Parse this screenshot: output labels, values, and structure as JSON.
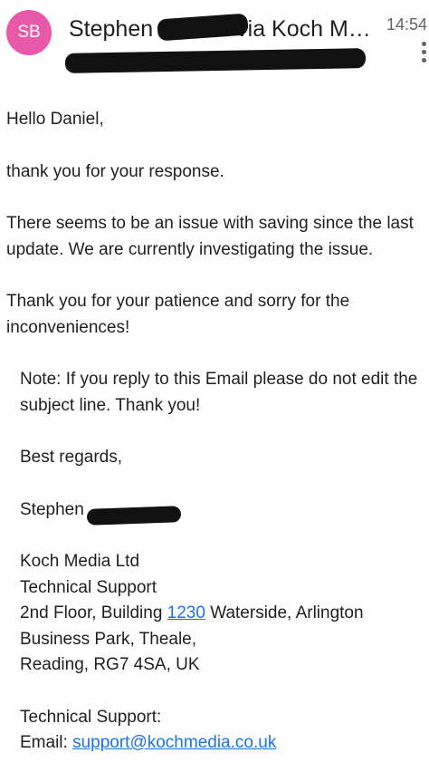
{
  "header": {
    "avatar_initials": "SB",
    "sender_first": "Stephen",
    "sender_via": "via Koch M…",
    "time": "14:54"
  },
  "email": {
    "greeting": "Hello Daniel,",
    "para1": "thank you for your response.",
    "para2": "There seems to be an issue with saving since the last update. We are currently investigating the issue.",
    "para3": "Thank you for your patience and sorry for the inconveniences!",
    "note": "Note: If you reply to this Email please do not edit the subject line. Thank you!",
    "closing": "Best regards,",
    "signature_name": "Stephen",
    "company": "Koch Media Ltd",
    "department": "Technical Support",
    "address_prefix": "2nd Floor, Building ",
    "address_link": "1230",
    "address_suffix": " Waterside, Arlington Business Park, Theale,",
    "address_line2": "Reading, RG7 4SA, UK",
    "support_label": "Technical Support:",
    "email_label": "Email: ",
    "email_link": "support@kochmedia.co.uk"
  },
  "colors": {
    "avatar_bg": "#e85aa7",
    "link": "#1a73e8",
    "text": "#1f1f1f",
    "muted": "#5f6368"
  }
}
